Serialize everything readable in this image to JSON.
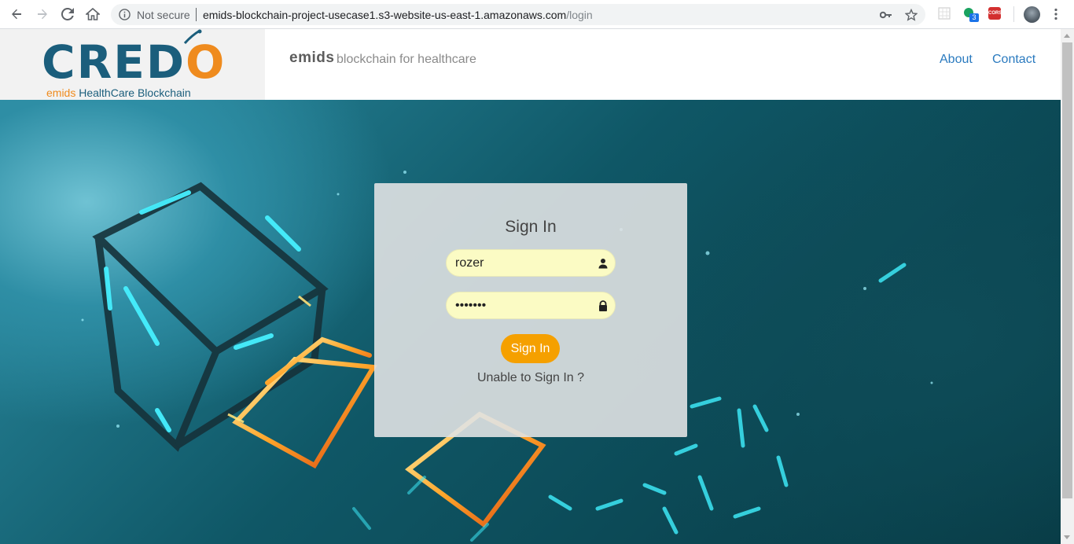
{
  "browser": {
    "security_label": "Not secure",
    "url_host": "emids-blockchain-project-usecase1.s3-website-us-east-1.amazonaws.com",
    "url_path": "/login",
    "extension_badge": "3",
    "cors_label": "CORS"
  },
  "header": {
    "logo_text": "CRED",
    "logo_o": "O",
    "logo_tagline_prefix": "emids",
    "logo_tagline": "HealthCare Blockchain",
    "brand": "emids",
    "brand_tagline": "blockchain for healthcare",
    "nav": {
      "about": "About",
      "contact": "Contact"
    }
  },
  "login": {
    "title": "Sign In",
    "username_value": "rozer",
    "password_value": "•••••••",
    "submit_label": "Sign In",
    "help_link": "Unable to Sign In ?"
  },
  "colors": {
    "accent_orange": "#f5a000",
    "link_blue": "#2a7abf",
    "logo_blue": "#1b5e7c",
    "field_bg": "#fbfbc4"
  }
}
